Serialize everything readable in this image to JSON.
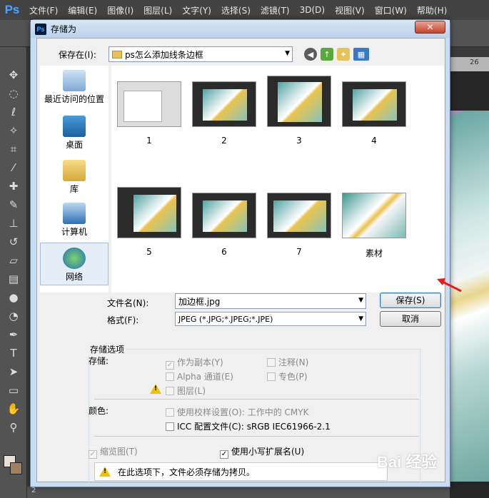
{
  "app": {
    "logo": "Ps"
  },
  "menubar": [
    "文件(F)",
    "编辑(E)",
    "图像(I)",
    "图层(L)",
    "文字(Y)",
    "选择(S)",
    "滤镜(T)",
    "3D(D)",
    "视图(V)",
    "窗口(W)",
    "帮助(H)"
  ],
  "ruler": {
    "mark": "26"
  },
  "status": {
    "left": "2"
  },
  "dialog": {
    "title": "存储为",
    "close_label": "✕",
    "save_in_label": "保存在(I):",
    "save_in_value": "ps怎么添加线条边框",
    "places": [
      {
        "label": "最近访问的位置",
        "icon": "recent-places-icon"
      },
      {
        "label": "桌面",
        "icon": "desktop-icon"
      },
      {
        "label": "库",
        "icon": "library-icon"
      },
      {
        "label": "计算机",
        "icon": "computer-icon"
      },
      {
        "label": "网络",
        "icon": "network-icon"
      }
    ],
    "files": [
      {
        "name": "1"
      },
      {
        "name": "2"
      },
      {
        "name": "3"
      },
      {
        "name": "4"
      },
      {
        "name": "5"
      },
      {
        "name": "6"
      },
      {
        "name": "7"
      },
      {
        "name": "素材"
      }
    ],
    "filename_label": "文件名(N):",
    "filename_value": "加边框.jpg",
    "format_label": "格式(F):",
    "format_value": "JPEG (*.JPG;*.JPEG;*.JPE)",
    "save_button": "保存(S)",
    "cancel_button": "取消",
    "options": {
      "group_title": "存储选项",
      "save_label": "存储:",
      "as_copy": "作为副本(Y)",
      "notes": "注释(N)",
      "alpha": "Alpha 通道(E)",
      "spot": "专色(P)",
      "layers": "图层(L)",
      "color_label": "颜色:",
      "use_proof": "使用校样设置(O):",
      "proof_value": "工作中的 CMYK",
      "icc": "ICC 配置文件(C):",
      "icc_value": "sRGB IEC61966-2.1",
      "thumbnail": "缩览图(T)",
      "lowercase": "使用小写扩展名(U)",
      "message": "在此选项下，文件必须存储为拷贝。"
    }
  },
  "watermark": "Bai 经验"
}
